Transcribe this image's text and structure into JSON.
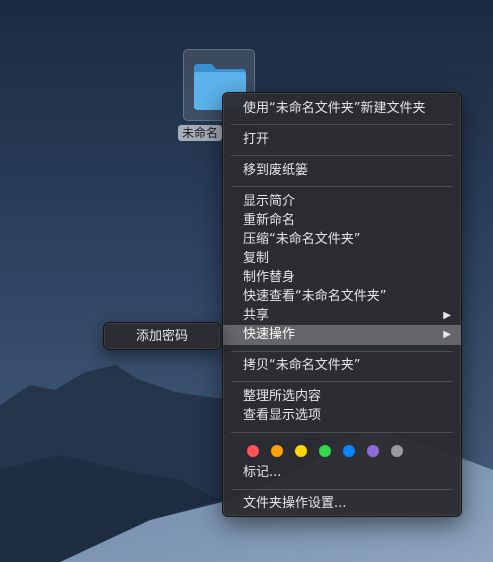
{
  "desktop": {
    "folder_label": "未命名"
  },
  "menu": {
    "new_folder_with_selection": "使用“未命名文件夹”新建文件夹",
    "open": "打开",
    "move_to_trash": "移到废纸篓",
    "get_info": "显示简介",
    "rename": "重新命名",
    "compress": "压缩“未命名文件夹”",
    "duplicate": "复制",
    "make_alias": "制作替身",
    "quick_look": "快速查看“未命名文件夹”",
    "share": "共享",
    "quick_actions": "快速操作",
    "copy": "拷贝“未命名文件夹”",
    "clean_up_selection": "整理所选内容",
    "show_view_options": "查看显示选项",
    "tags": "标记...",
    "folder_actions_setup": "文件夹操作设置...",
    "submenu_arrow": "▶",
    "tag_colors": [
      "#ff5257",
      "#ff9f0a",
      "#ffd60a",
      "#32d74b",
      "#0a84ff",
      "#8e6bd8",
      "#9a9a9e"
    ]
  },
  "submenu": {
    "add_password": "添加密码"
  }
}
